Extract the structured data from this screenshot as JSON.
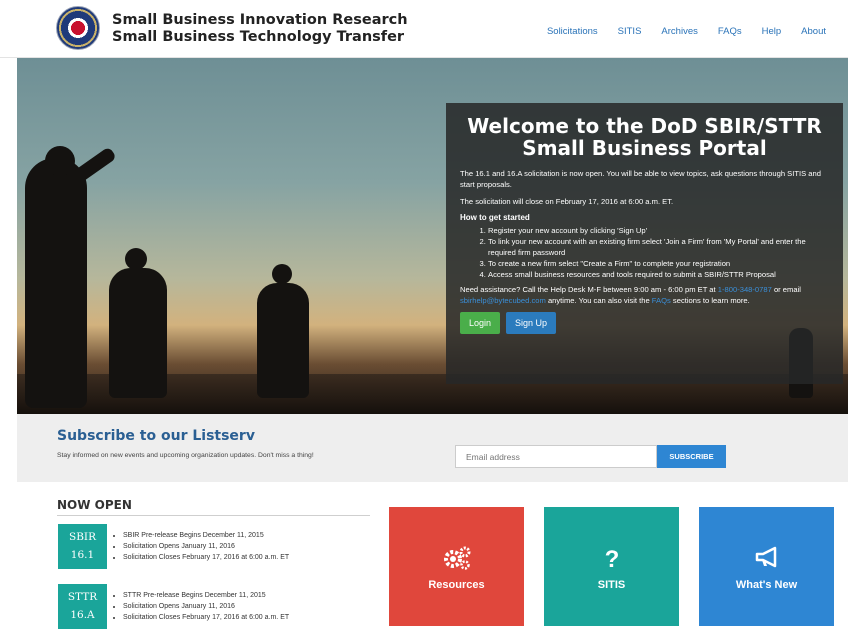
{
  "header": {
    "org_line1": "Small Business Innovation Research",
    "org_line2": "Small Business Technology Transfer",
    "nav": [
      "Solicitations",
      "SITIS",
      "Archives",
      "FAQs",
      "Help",
      "About"
    ]
  },
  "hero": {
    "title_line1": "Welcome to the DoD SBIR/STTR",
    "title_line2": "Small Business Portal",
    "para1": "The 16.1 and 16.A solicitation is now open. You will be able to view topics, ask questions through SITIS and start proposals.",
    "para2": "The solicitation will close on February 17, 2016 at 6:00 a.m. ET.",
    "how_heading": "How to get started",
    "steps": [
      "Register your new account by clicking 'Sign Up'",
      "To link your new account with an existing firm select 'Join a Firm' from 'My Portal' and enter the required firm password",
      "To create a new firm select \"Create a Firm\" to complete your registration",
      "Access small business resources and tools required to submit a SBIR/STTR Proposal"
    ],
    "assist_pre": "Need assistance? Call the Help Desk M-F between 9:00 am - 6:00 pm ET at",
    "assist_phone": "1-800-348-0787",
    "assist_mid1": "or email",
    "assist_email": "sbirhelp@bytecubed.com",
    "assist_mid2": "anytime. You can also visit the",
    "assist_faq": "FAQs",
    "assist_post": "sections to learn more.",
    "login_label": "Login",
    "signup_label": "Sign Up"
  },
  "subscribe": {
    "title": "Subscribe to our Listserv",
    "text": "Stay informed on new events and upcoming organization updates. Don't miss a thing!",
    "email_placeholder": "Email address",
    "button_label": "SUBSCRIBE"
  },
  "now_open": {
    "heading": "NOW OPEN",
    "programs": [
      {
        "line1": "SBIR",
        "line2": "16.1",
        "items": [
          "SBIR Pre-release Begins December 11, 2015",
          "Solicitation Opens January 11, 2016",
          "Solicitation Closes February 17, 2016 at 6:00 a.m. ET"
        ]
      },
      {
        "line1": "STTR",
        "line2": "16.A",
        "items": [
          "STTR Pre-release Begins December 11, 2015",
          "Solicitation Opens January 11, 2016",
          "Solicitation Closes February 17, 2016 at 6:00 a.m. ET"
        ]
      }
    ]
  },
  "tiles": [
    {
      "label": "Resources",
      "icon": "gears-icon",
      "color": "#e0473c"
    },
    {
      "label": "SITIS",
      "icon": "question-icon",
      "color": "#1aa59a"
    },
    {
      "label": "What's New",
      "icon": "megaphone-icon",
      "color": "#2e86d3"
    }
  ]
}
